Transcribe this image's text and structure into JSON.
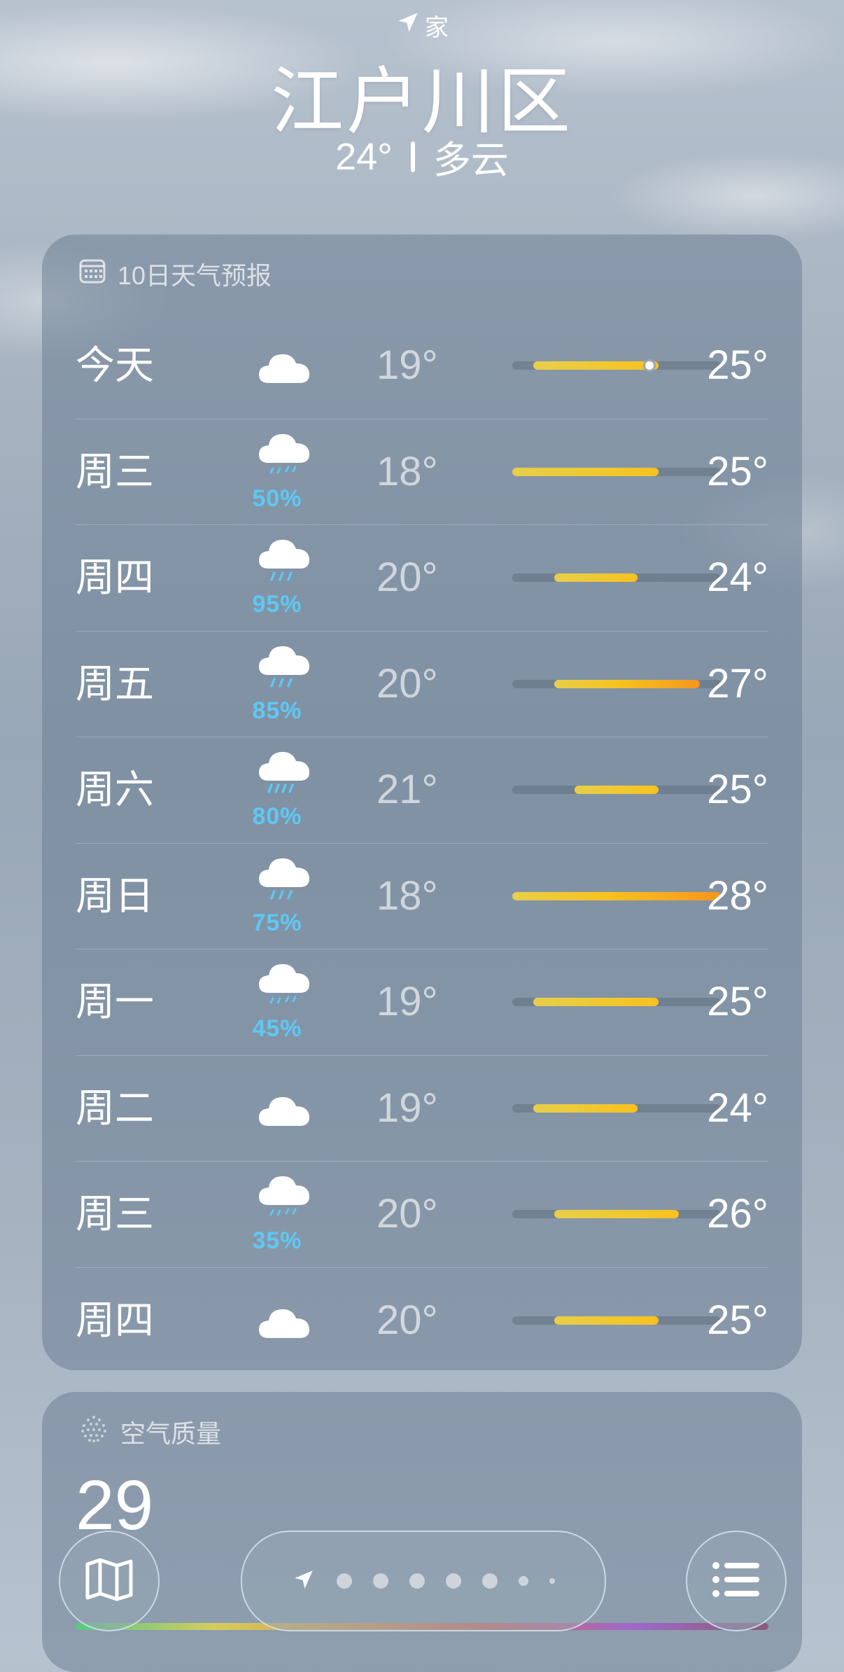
{
  "header": {
    "location_label": "家",
    "city": "江户川区",
    "current_temp": "24°",
    "condition": "多云"
  },
  "forecast": {
    "title": "10日天气预报",
    "days": [
      {
        "day": "今天",
        "icon": "cloud-icon",
        "precip": "",
        "low": "19°",
        "high": "25°",
        "current": true
      },
      {
        "day": "周三",
        "icon": "cloud-drizzle-icon",
        "precip": "50%",
        "low": "18°",
        "high": "25°"
      },
      {
        "day": "周四",
        "icon": "cloud-rain-icon",
        "precip": "95%",
        "low": "20°",
        "high": "24°"
      },
      {
        "day": "周五",
        "icon": "cloud-rain-icon",
        "precip": "85%",
        "low": "20°",
        "high": "27°"
      },
      {
        "day": "周六",
        "icon": "cloud-heavy-rain-icon",
        "precip": "80%",
        "low": "21°",
        "high": "25°"
      },
      {
        "day": "周日",
        "icon": "cloud-rain-icon",
        "precip": "75%",
        "low": "18°",
        "high": "28°"
      },
      {
        "day": "周一",
        "icon": "cloud-drizzle-icon",
        "precip": "45%",
        "low": "19°",
        "high": "25°"
      },
      {
        "day": "周二",
        "icon": "cloud-icon",
        "precip": "",
        "low": "19°",
        "high": "24°"
      },
      {
        "day": "周三",
        "icon": "cloud-drizzle-icon",
        "precip": "35%",
        "low": "20°",
        "high": "26°"
      },
      {
        "day": "周四",
        "icon": "cloud-icon",
        "precip": "",
        "low": "20°",
        "high": "25°"
      }
    ]
  },
  "air_quality": {
    "title": "空气质量",
    "value": "29"
  },
  "colors": {
    "precip_blue": "#5ec8f5",
    "bar_yellow": "#f7c21f",
    "bar_orange": "#f5961e"
  },
  "toolbar": {
    "map_icon": "map-icon",
    "list_icon": "list-icon",
    "page_count": 7
  }
}
